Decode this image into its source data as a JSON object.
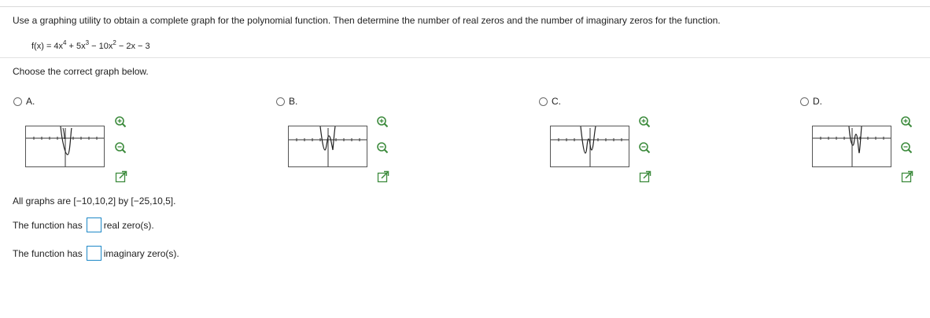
{
  "question": {
    "instruction": "Use a graphing utility to obtain a complete graph for the polynomial function. Then determine the number of real zeros and the number of imaginary zeros for the function.",
    "function": {
      "prefix": "f(x) = 4x",
      "exp1": "4",
      "part2": " + 5x",
      "exp2": "3",
      "part3": " − 10x",
      "exp3": "2",
      "part4": " − 2x − 3"
    },
    "choose_prompt": "Choose the correct graph below."
  },
  "options": [
    {
      "letter": "A.",
      "selected": false
    },
    {
      "letter": "B.",
      "selected": false
    },
    {
      "letter": "C.",
      "selected": false
    },
    {
      "letter": "D.",
      "selected": false
    }
  ],
  "tool_icons": [
    "zoom-in-icon",
    "zoom-out-icon",
    "expand-icon"
  ],
  "range_text": "All graphs are [−10,10,2] by [−25,10,5].",
  "answers": [
    {
      "prefix": "The function has",
      "suffix": "real zero(s).",
      "value": ""
    },
    {
      "prefix": "The function has",
      "suffix": "imaginary zero(s).",
      "value": ""
    }
  ],
  "colors": {
    "accent": "#1e88c7",
    "icon": "#3d8b3d",
    "text": "#222222"
  }
}
